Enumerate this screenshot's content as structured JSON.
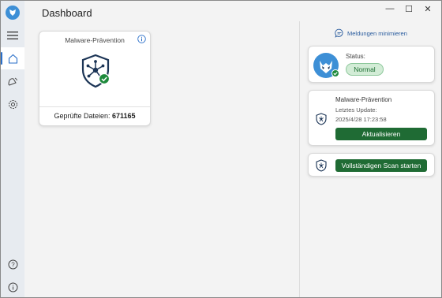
{
  "window": {
    "title": "Dashboard",
    "controls": [
      "—",
      "☐",
      "✕"
    ]
  },
  "rail": {
    "items": [
      {
        "icon": "menu-icon"
      },
      {
        "icon": "home-icon",
        "active": true
      },
      {
        "icon": "alerts-icon"
      },
      {
        "icon": "gear-icon"
      },
      {
        "icon": "help-icon"
      },
      {
        "icon": "info-icon"
      }
    ]
  },
  "main": {
    "malware_card": {
      "title": "Malware-Prävention",
      "scanned_label": "Geprüfte Dateien:",
      "scanned_count": "671165"
    }
  },
  "right": {
    "minimize_label": "Meldungen minimieren",
    "status": {
      "label": "Status:",
      "value": "Normal"
    },
    "update": {
      "title": "Malware-Prävention",
      "last_update_label": "Letztes Update:",
      "last_update_value": "2025/4/28 17:23:58",
      "button": "Aktualisieren"
    },
    "scan": {
      "button": "Vollständigen Scan starten"
    }
  },
  "colors": {
    "accent": "#3d8fd6",
    "button_green": "#1f6b34",
    "status_green_bg": "#d2ecd6",
    "shield_dark": "#1c3556",
    "check_green": "#1e8a3c"
  }
}
